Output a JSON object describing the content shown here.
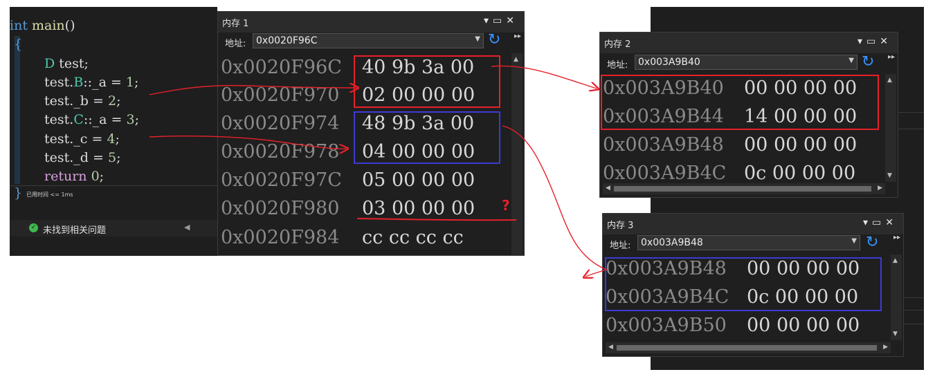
{
  "editor": {
    "lines": [
      {
        "t1": "int",
        "t2": " main",
        "t3": "()"
      },
      {
        "brace": "{"
      },
      {
        "ty": "D",
        "rest": " test;"
      },
      {
        "pre": "test.",
        "ty": "B",
        "mid": "::_a = ",
        "num": "1",
        "end": ";"
      },
      {
        "pre": "test._b = ",
        "num": "2",
        "end": ";"
      },
      {
        "pre": "test.",
        "ty": "C",
        "mid": "::_a = ",
        "num": "3",
        "end": ";"
      },
      {
        "pre": "test._c = ",
        "num": "4",
        "end": ";"
      },
      {
        "pre": "test._d = ",
        "num": "5",
        "end": ";"
      },
      {
        "ctl": "return",
        "num": " 0",
        "end": ";"
      },
      {
        "brace": "}"
      }
    ],
    "elapsed": "已用时间 <= 1ms",
    "status": "未找到相关问题",
    "status_icon": "check-circle-icon"
  },
  "memory1": {
    "title": "内存 1",
    "address_label": "地址:",
    "address": "0x0020F96C",
    "rows": [
      {
        "addr": "0x0020F96C",
        "bytes": "40 9b 3a 00"
      },
      {
        "addr": "0x0020F970",
        "bytes": "02 00 00 00"
      },
      {
        "addr": "0x0020F974",
        "bytes": "48 9b 3a 00"
      },
      {
        "addr": "0x0020F978",
        "bytes": "04 00 00 00"
      },
      {
        "addr": "0x0020F97C",
        "bytes": "05 00 00 00"
      },
      {
        "addr": "0x0020F980",
        "bytes": "03 00 00 00"
      },
      {
        "addr": "0x0020F984",
        "bytes": "cc cc cc cc"
      }
    ],
    "question_mark": "?"
  },
  "memory2": {
    "title": "内存 2",
    "address_label": "地址:",
    "address": "0x003A9B40",
    "rows": [
      {
        "addr": "0x003A9B40",
        "bytes": "00 00 00 00"
      },
      {
        "addr": "0x003A9B44",
        "bytes": "14 00 00 00"
      },
      {
        "addr": "0x003A9B48",
        "bytes": "00 00 00 00"
      },
      {
        "addr": "0x003A9B4C",
        "bytes": "0c 00 00 00"
      }
    ]
  },
  "memory3": {
    "title": "内存 3",
    "address_label": "地址:",
    "address": "0x003A9B48",
    "rows": [
      {
        "addr": "0x003A9B48",
        "bytes": "00 00 00 00"
      },
      {
        "addr": "0x003A9B4C",
        "bytes": "0c 00 00 00"
      },
      {
        "addr": "0x003A9B50",
        "bytes": "00 00 00 00"
      }
    ]
  },
  "colors": {
    "annotation_red": "#e8202a",
    "annotation_blue": "#3b3bd6",
    "editor_bg": "#1e1e1e",
    "memory_bg": "#1f1f1f"
  },
  "window_controls": {
    "dropdown": "▾",
    "maximize": "▭",
    "close": "✕"
  },
  "icons": {
    "refresh": "refresh-icon",
    "overflow": "overflow-icon"
  }
}
